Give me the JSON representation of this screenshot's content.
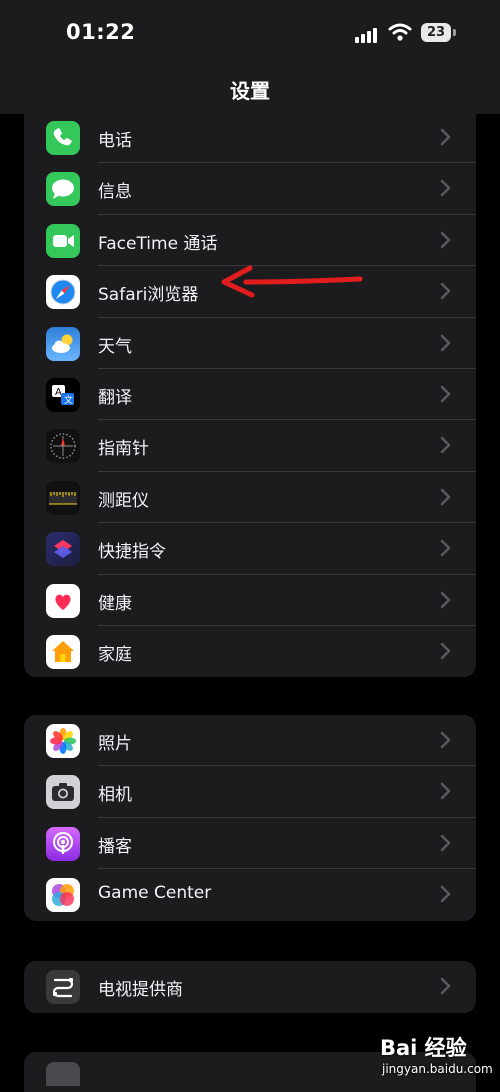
{
  "status_bar": {
    "time": "01:22",
    "battery": "23"
  },
  "header": {
    "title": "设置"
  },
  "groups": [
    {
      "items": [
        {
          "label": "电话",
          "icon": "phone-icon"
        },
        {
          "label": "信息",
          "icon": "messages-icon"
        },
        {
          "label": "FaceTime 通话",
          "icon": "facetime-icon"
        },
        {
          "label": "Safari浏览器",
          "icon": "safari-icon"
        },
        {
          "label": "天气",
          "icon": "weather-icon"
        },
        {
          "label": "翻译",
          "icon": "translate-icon"
        },
        {
          "label": "指南针",
          "icon": "compass-icon"
        },
        {
          "label": "测距仪",
          "icon": "measure-icon"
        },
        {
          "label": "快捷指令",
          "icon": "shortcuts-icon"
        },
        {
          "label": "健康",
          "icon": "health-icon"
        },
        {
          "label": "家庭",
          "icon": "home-icon"
        }
      ]
    },
    {
      "items": [
        {
          "label": "照片",
          "icon": "photos-icon"
        },
        {
          "label": "相机",
          "icon": "camera-icon"
        },
        {
          "label": "播客",
          "icon": "podcasts-icon"
        },
        {
          "label": "Game Center",
          "icon": "game-center-icon"
        }
      ]
    },
    {
      "items": [
        {
          "label": "电视提供商",
          "icon": "tv-provider-icon"
        }
      ]
    }
  ],
  "watermark": {
    "main": "Bai 经验",
    "sub": "jingyan.baidu.com"
  },
  "colors": {
    "chevron": "#5a5a5e",
    "annotation_arrow": "#e11d1d",
    "group_bg": "#1c1c1e"
  }
}
